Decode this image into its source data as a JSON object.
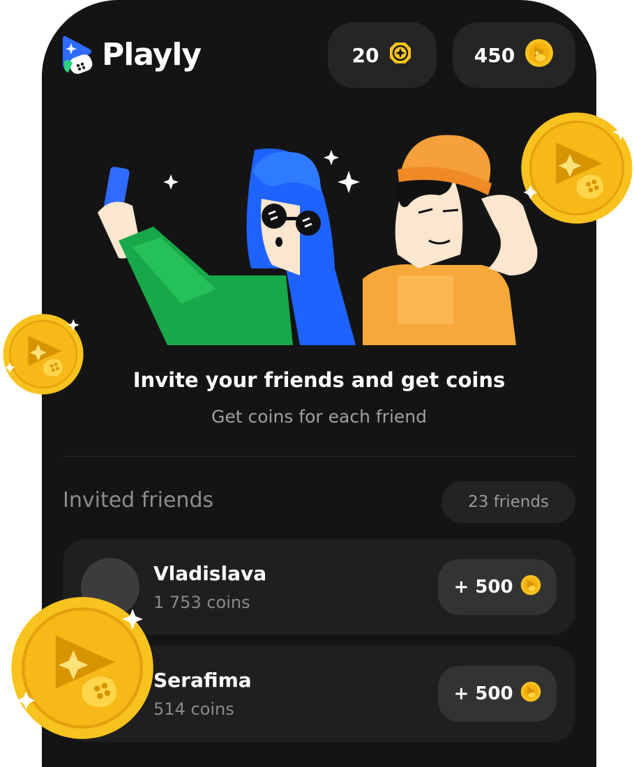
{
  "header": {
    "brand": "Playly",
    "tokens": "20",
    "coins": "450"
  },
  "hero": {
    "title": "Invite your friends and get coins",
    "subtitle": "Get coins for each friend"
  },
  "friends": {
    "section_title": "Invited friends",
    "count": "23 friends",
    "items": [
      {
        "name": "Vladislava",
        "coins": "1 753 coins",
        "bonus": "+ 500"
      },
      {
        "name": "Serafima",
        "coins": "514 coins",
        "bonus": "+ 500"
      }
    ]
  },
  "colors": {
    "background": "#141414",
    "card": "#1f1f1f",
    "pill": "#252525",
    "coin_gold": "#F9C31F",
    "brand_blue": "#2F6BFF"
  }
}
